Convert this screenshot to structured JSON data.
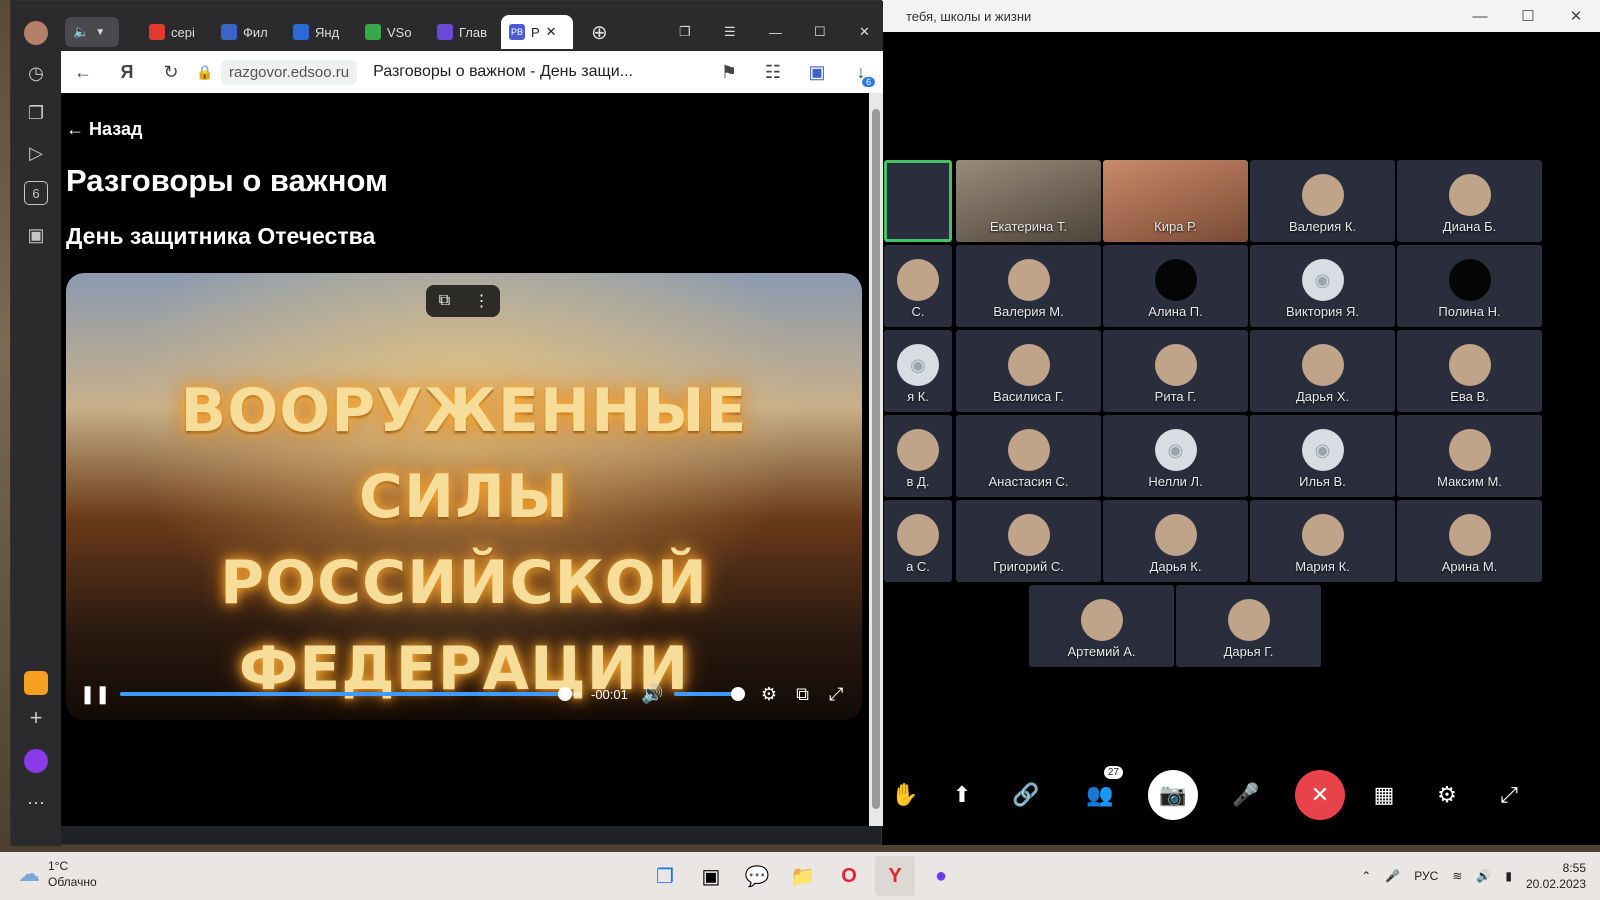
{
  "conference": {
    "title": "тебя, школы и жизни",
    "participants_count": "27",
    "tiles": [
      {
        "name": "",
        "style": "active"
      },
      {
        "name": "Екатерина Т.",
        "style": "photo"
      },
      {
        "name": "Кира Р.",
        "style": "photo2"
      },
      {
        "name": "Валерия К.",
        "style": "ava"
      },
      {
        "name": "Диана Б.",
        "style": "ava"
      },
      {
        "name": "С.",
        "style": "ava"
      },
      {
        "name": "Валерия М.",
        "style": "ava"
      },
      {
        "name": "Алина П.",
        "style": "dark"
      },
      {
        "name": "Виктория Я.",
        "style": "cam"
      },
      {
        "name": "Полина Н.",
        "style": "dark"
      },
      {
        "name": "я К.",
        "style": "cam"
      },
      {
        "name": "Василиса Г.",
        "style": "ava"
      },
      {
        "name": "Рита Г.",
        "style": "ava"
      },
      {
        "name": "Дарья Х.",
        "style": "ava"
      },
      {
        "name": "Ева В.",
        "style": "ava"
      },
      {
        "name": "в Д.",
        "style": "ava"
      },
      {
        "name": "Анастасия С.",
        "style": "ava"
      },
      {
        "name": "Нелли Л.",
        "style": "cam"
      },
      {
        "name": "Илья В.",
        "style": "cam"
      },
      {
        "name": "Максим М.",
        "style": "ava"
      },
      {
        "name": "а С.",
        "style": "ava"
      },
      {
        "name": "Григорий С.",
        "style": "ava"
      },
      {
        "name": "Дарья К.",
        "style": "ava"
      },
      {
        "name": "Мария К.",
        "style": "ava"
      },
      {
        "name": "Арина М.",
        "style": "ava"
      },
      {
        "name": "Артемий А.",
        "style": "ava"
      },
      {
        "name": "Дарья Г.",
        "style": "ava"
      }
    ]
  },
  "browser": {
    "tabs": [
      {
        "label": "серi",
        "color": "#e23a2e"
      },
      {
        "label": "Фил",
        "color": "#3b63c9"
      },
      {
        "label": "Янд",
        "color": "#2a6ad8"
      },
      {
        "label": "VSo",
        "color": "#3aa84a"
      },
      {
        "label": "Глав",
        "color": "#6a4ad8"
      },
      {
        "label": "Р",
        "color": "#4b5bd8",
        "fav_text": "РВ"
      }
    ],
    "url_domain": "razgovor.edsoo.ru",
    "url_title": "Разговоры о важном - День защи...",
    "downloads_badge": "6",
    "sidebar_badge": "6"
  },
  "page": {
    "back_label": "← Назад",
    "title": "Разговоры о важном",
    "subtitle": "День защитника Отечества"
  },
  "video": {
    "line1": "ВООРУЖЕННЫЕ СИЛЫ",
    "line2": "РОССИЙСКОЙ",
    "line3": "ФЕДЕРАЦИИ",
    "time_remaining": "-00:01",
    "progress": 0.95,
    "volume": 1.0
  },
  "taskbar": {
    "temp": "1°C",
    "condition": "Облачно",
    "language": "РУС",
    "time": "8:55",
    "date": "20.02.2023"
  },
  "colors": {
    "accent_blue": "#3d9bff",
    "hangup_red": "#e8434b",
    "active_speaker": "#43c463"
  }
}
